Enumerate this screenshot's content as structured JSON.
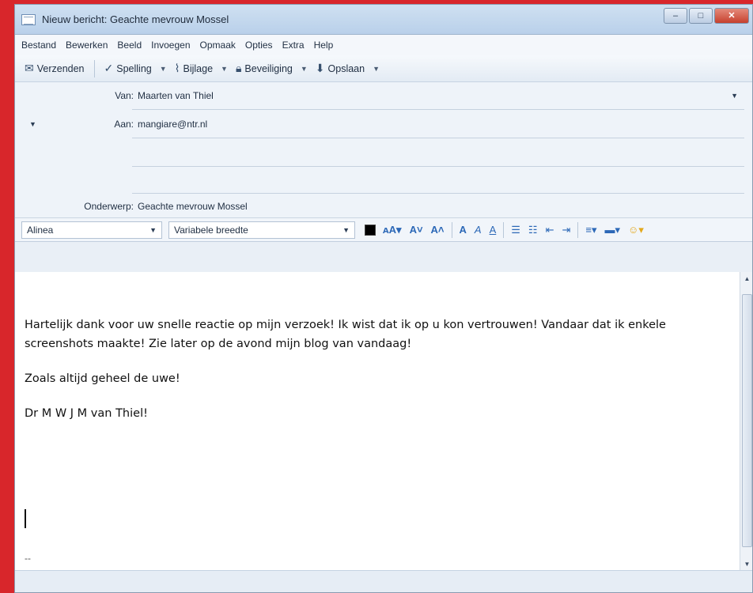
{
  "window": {
    "title": "Nieuw bericht: Geachte mevrouw Mossel",
    "controls": {
      "minimize": "–",
      "maximize": "□",
      "close": "✕"
    }
  },
  "menu": [
    "Bestand",
    "Bewerken",
    "Beeld",
    "Invoegen",
    "Opmaak",
    "Opties",
    "Extra",
    "Help"
  ],
  "toolbar": {
    "send": "Verzenden",
    "spelling": "Spelling",
    "attachment": "Bijlage",
    "security": "Beveiliging",
    "save": "Opslaan"
  },
  "headers": {
    "from_label": "Van:",
    "from_value": "Maarten van Thiel",
    "to_label": "Aan:",
    "to_value": "mangiare@ntr.nl",
    "subject_label": "Onderwerp:",
    "subject_value": "Geachte mevrouw Mossel"
  },
  "format": {
    "paragraph_style": "Alinea",
    "font": "Variabele breedte"
  },
  "body": {
    "paragraph1": "Hartelijk dank voor uw snelle reactie op mijn verzoek! Ik wist dat ik op u kon vertrouwen! Vandaar dat ik enkele screenshots maakte! Zie later op de avond mijn blog van vandaag!",
    "paragraph2": "Zoals altijd geheel de uwe!",
    "paragraph3": "Dr M W J M van Thiel!",
    "signature_sep": "--"
  },
  "colors": {
    "background": "#d8262b",
    "window": "#e9eff6",
    "accent": "#2c68b7"
  }
}
